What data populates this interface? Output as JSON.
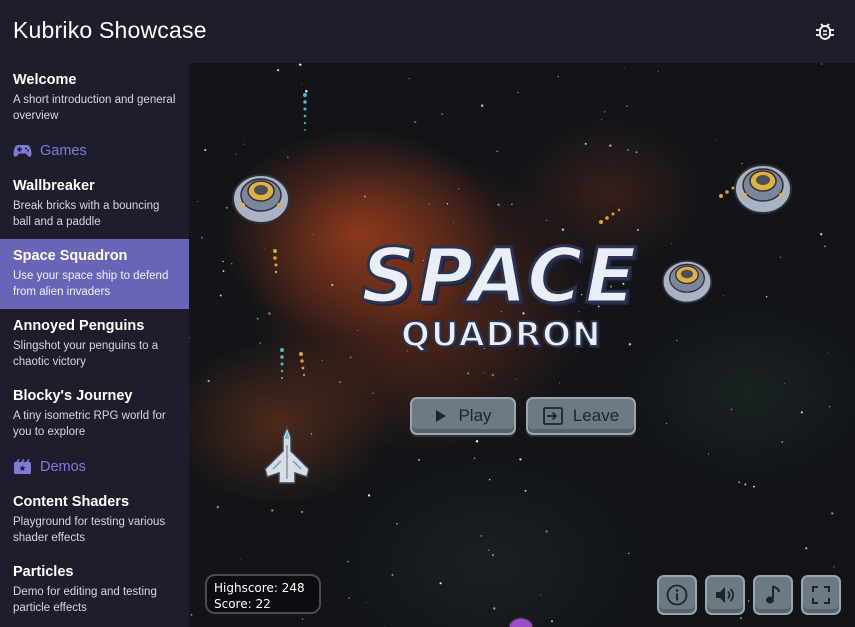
{
  "header": {
    "title": "Kubriko Showcase",
    "bug_icon": "bug-icon"
  },
  "sidebar": {
    "items": [
      {
        "title": "Welcome",
        "desc": "A short introduction and general overview"
      },
      {
        "title": "Wallbreaker",
        "desc": "Break bricks with a bouncing ball and a paddle"
      },
      {
        "title": "Space Squadron",
        "desc": "Use your space ship to defend from alien invaders",
        "active": true
      },
      {
        "title": "Annoyed Penguins",
        "desc": "Slingshot your penguins to a chaotic victory"
      },
      {
        "title": "Blocky's Journey",
        "desc": "A tiny isometric RPG world for you to explore"
      },
      {
        "title": "Content Shaders",
        "desc": "Playground for testing various shader effects"
      },
      {
        "title": "Particles",
        "desc": "Demo for editing and testing particle effects"
      }
    ],
    "sections": [
      {
        "label": "Games",
        "icon": "gamepad-icon"
      },
      {
        "label": "Demos",
        "icon": "demos-icon"
      }
    ]
  },
  "game": {
    "logo_line1": "SPACE",
    "logo_line2": "QUADRON",
    "play_label": "Play",
    "leave_label": "Leave",
    "highscore_text": "Highscore: 248",
    "score_text": "Score: 22",
    "controls": [
      "info-icon",
      "volume-icon",
      "music-icon",
      "fullscreen-icon"
    ]
  },
  "colors": {
    "accent": "#6865b8",
    "section": "#7f7cd8",
    "background": "#1e1d2e"
  }
}
